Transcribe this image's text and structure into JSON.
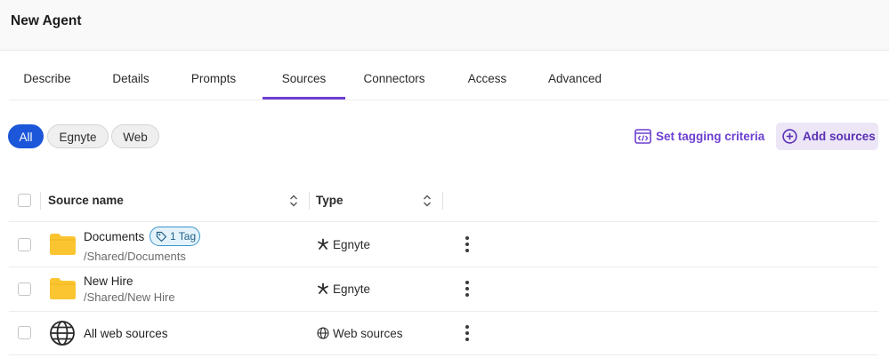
{
  "header": {
    "title": "New Agent"
  },
  "tabs": [
    {
      "label": "Describe"
    },
    {
      "label": "Details"
    },
    {
      "label": "Prompts"
    },
    {
      "label": "Sources",
      "active": true
    },
    {
      "label": "Connectors"
    },
    {
      "label": "Access"
    },
    {
      "label": "Advanced"
    }
  ],
  "filters": [
    {
      "label": "All",
      "active": true
    },
    {
      "label": "Egnyte"
    },
    {
      "label": "Web"
    }
  ],
  "actions": {
    "set_tagging_label": "Set tagging criteria",
    "set_tagging_icon": "code-window-icon",
    "add_sources_label": "Add sources",
    "add_sources_icon": "plus-circle-icon"
  },
  "table": {
    "columns": [
      {
        "label": "Source name",
        "sortable": true
      },
      {
        "label": "Type",
        "sortable": true
      }
    ],
    "rows": [
      {
        "name": "Documents",
        "path": "/Shared/Documents",
        "tag": "1 Tag",
        "type": "Egnyte",
        "icon": "folder-icon",
        "type_icon": "egnyte-icon"
      },
      {
        "name": "New Hire",
        "path": "/Shared/New Hire",
        "type": "Egnyte",
        "icon": "folder-icon",
        "type_icon": "egnyte-icon"
      },
      {
        "name": "All web sources",
        "type": "Web sources",
        "icon": "globe-icon",
        "type_icon": "globe-icon"
      }
    ]
  },
  "colors": {
    "accent": "#6c3fd1",
    "chip_active": "#1c57d9",
    "folder": "#fbc531",
    "tag_border": "#3a95c8"
  }
}
